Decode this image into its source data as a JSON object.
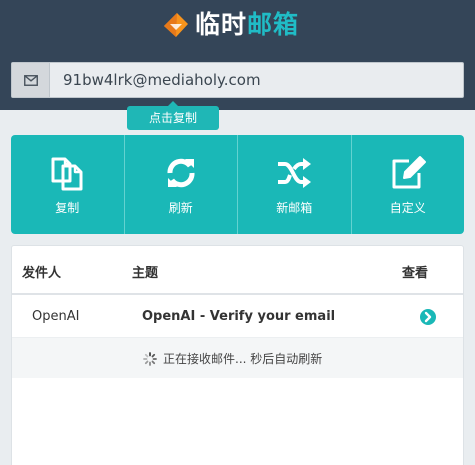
{
  "brand": {
    "name_part1": "临时",
    "name_part2": "邮箱"
  },
  "email": {
    "address": "91bw4lrk@mediaholy.com",
    "tooltip": "点击复制"
  },
  "actions": [
    {
      "label": "复制",
      "icon": "copy-icon"
    },
    {
      "label": "刷新",
      "icon": "refresh-icon"
    },
    {
      "label": "新邮箱",
      "icon": "shuffle-icon"
    },
    {
      "label": "自定义",
      "icon": "edit-icon"
    }
  ],
  "inbox": {
    "columns": {
      "sender": "发件人",
      "subject": "主题",
      "view": "查看"
    },
    "messages": [
      {
        "sender": "OpenAI",
        "subject": "OpenAI - Verify your email"
      }
    ],
    "status": "正在接收邮件... 秒后自动刷新"
  },
  "colors": {
    "header_bg": "#344558",
    "accent": "#1ab8b7",
    "brand_orange": "#f7941d"
  }
}
